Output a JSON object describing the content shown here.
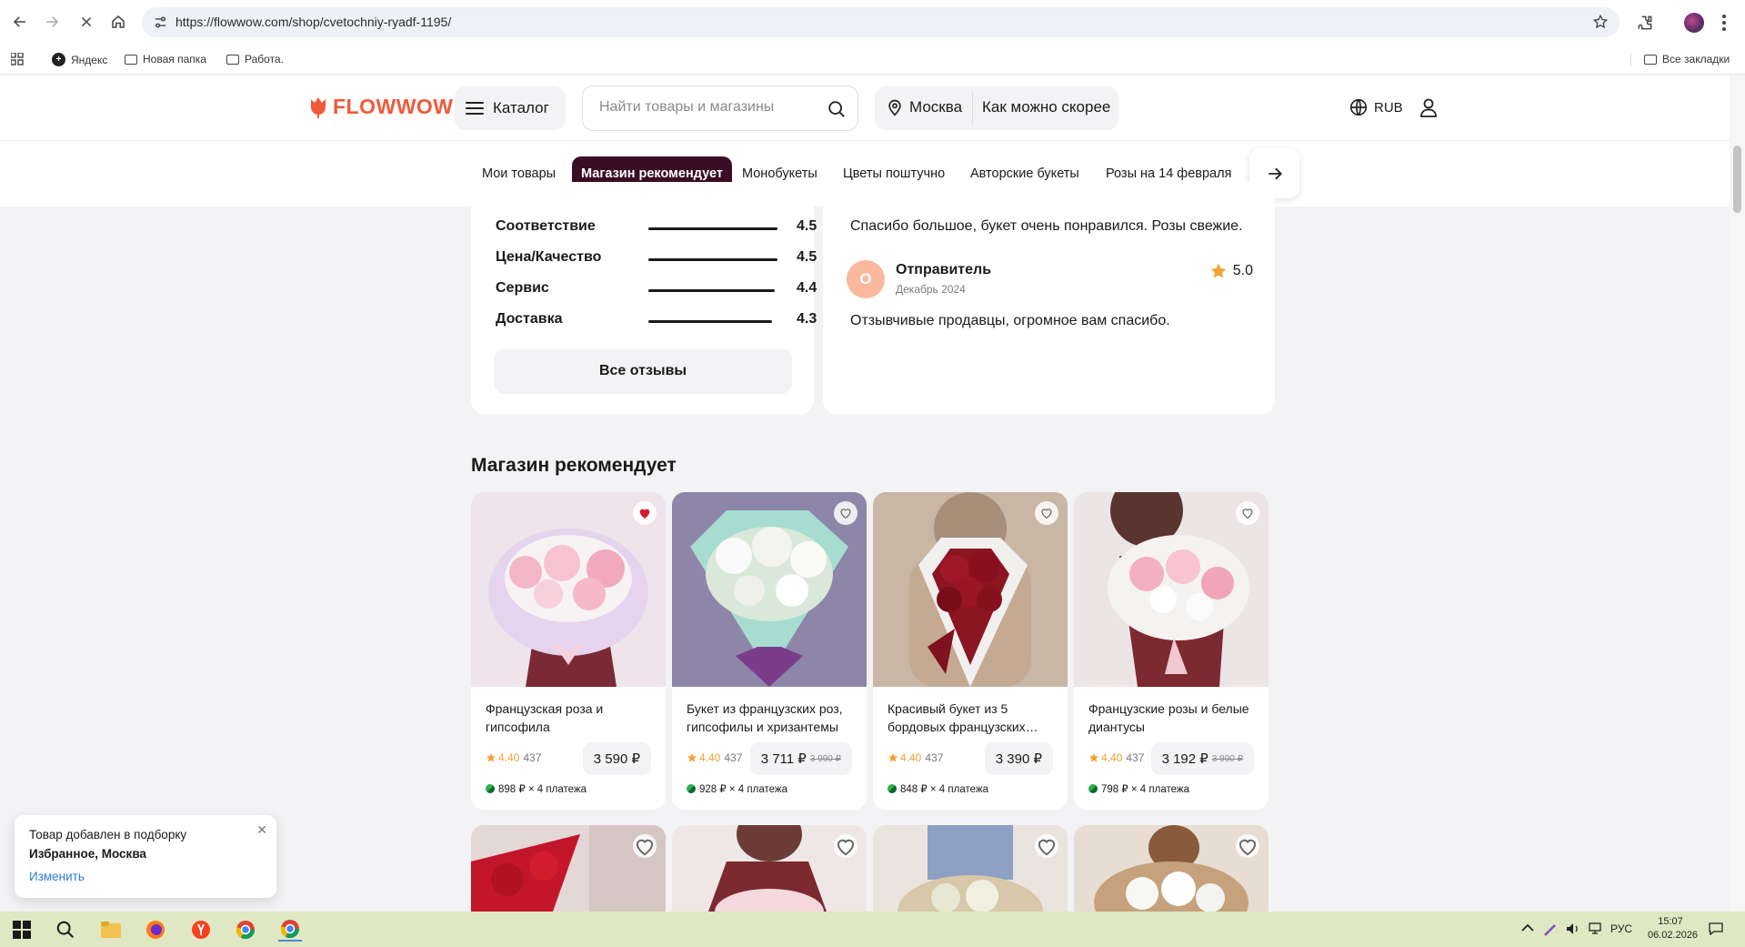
{
  "browser": {
    "url": "https://flowwow.com/shop/cvetochniy-ryadf-1195/",
    "bookmarks": [
      {
        "label": "Яндекс",
        "icon": "yandex-icon"
      },
      {
        "label": "Новая папка",
        "icon": "folder-icon"
      },
      {
        "label": "Работа.",
        "icon": "folder-icon"
      }
    ],
    "all_bookmarks": "Все закладки"
  },
  "header": {
    "logo": "FLOWWOW",
    "catalog": "Каталог",
    "search_placeholder": "Найти товары и магазины",
    "city": "Москва",
    "delivery_time": "Как можно скорее",
    "currency": "RUB"
  },
  "tabs": [
    {
      "label": "Мои товары",
      "active": false
    },
    {
      "label": "Магазин рекомендует",
      "active": true
    },
    {
      "label": "Монобукеты",
      "active": false
    },
    {
      "label": "Цветы поштучно",
      "active": false
    },
    {
      "label": "Авторские букеты",
      "active": false
    },
    {
      "label": "Розы на 14 февраля",
      "active": false
    }
  ],
  "ratings": [
    {
      "label": "Соответствие",
      "value": "4.5",
      "score": 4.5
    },
    {
      "label": "Цена/Качество",
      "value": "4.5",
      "score": 4.5
    },
    {
      "label": "Сервис",
      "value": "4.4",
      "score": 4.4
    },
    {
      "label": "Доставка",
      "value": "4.3",
      "score": 4.3
    }
  ],
  "all_reviews": "Все отзывы",
  "reviews": {
    "first_text": "Спасибо большое, букет очень понравился. Розы свежие.",
    "author_initial": "О",
    "author": "Отправитель",
    "date": "Декабрь 2024",
    "score": "5.0",
    "second_text": "Отзывчивые продавцы, огромное вам спасибо."
  },
  "section_title": "Магазин рекомендует",
  "products": [
    {
      "name": "Французская роза и гипсофила",
      "rating": "4.40",
      "count": "437",
      "price": "3 590 ₽",
      "old_price": "",
      "installment": "898 ₽ × 4 платежа",
      "favorite": true
    },
    {
      "name": "Букет из французских роз, гипсофилы и хризантемы",
      "rating": "4.40",
      "count": "437",
      "price": "3 711 ₽",
      "old_price": "3 990 ₽",
      "installment": "928 ₽ × 4 платежа",
      "favorite": false
    },
    {
      "name": "Красивый букет из 5 бордовых французских…",
      "rating": "4.40",
      "count": "437",
      "price": "3 390 ₽",
      "old_price": "",
      "installment": "848 ₽ × 4 платежа",
      "favorite": false
    },
    {
      "name": "Французские розы и белые диантусы",
      "rating": "4.40",
      "count": "437",
      "price": "3 192 ₽",
      "old_price": "3 990 ₽",
      "installment": "798 ₽ × 4 платежа",
      "favorite": false
    }
  ],
  "toast": {
    "line1": "Товар добавлен в подборку",
    "line2": "Избранное, Москва",
    "action": "Изменить"
  },
  "taskbar": {
    "lang": "РУС",
    "time": "15:07",
    "date": "06.02.2026"
  },
  "colors": {
    "brand": "#f05a3a",
    "active_tab": "#3a0d24",
    "star": "#f3a233",
    "link": "#2f7bd6"
  }
}
